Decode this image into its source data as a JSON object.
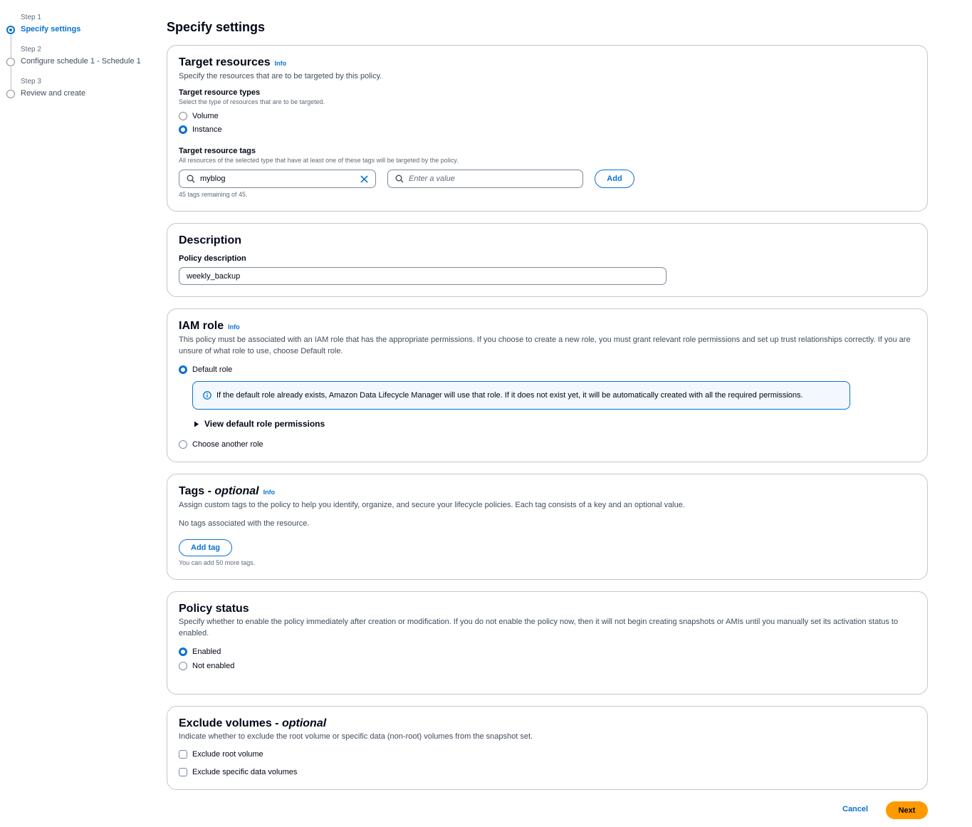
{
  "steps": [
    {
      "sub": "Step 1",
      "label": "Specify settings"
    },
    {
      "sub": "Step 2",
      "label": "Configure schedule 1 - Schedule 1"
    },
    {
      "sub": "Step 3",
      "label": "Review and create"
    }
  ],
  "page_title": "Specify settings",
  "target_resources": {
    "title": "Target resources",
    "info": "Info",
    "description": "Specify the resources that are to be targeted by this policy.",
    "types_label": "Target resource types",
    "types_hint": "Select the type of resources that are to be targeted.",
    "type_volume": "Volume",
    "type_instance": "Instance",
    "tags_label": "Target resource tags",
    "tags_hint": "All resources of the selected type that have at least one of these tags will be targeted by the policy.",
    "key_value": "myblog",
    "value_placeholder": "Enter a value",
    "add_label": "Add",
    "remaining": "45 tags remaining of 45."
  },
  "description_panel": {
    "title": "Description",
    "label": "Policy description",
    "value": "weekly_backup"
  },
  "iam_role": {
    "title": "IAM role",
    "info": "Info",
    "description": "This policy must be associated with an IAM role that has the appropriate permissions. If you choose to create a new role, you must grant relevant role permissions and set up trust relationships correctly. If you are unsure of what role to use, choose Default role.",
    "default_role": "Default role",
    "alert_text": "If the default role already exists, Amazon Data Lifecycle Manager will use that role. If it does not exist yet, it will be automatically created with all the required permissions.",
    "expand_label": "View default role permissions",
    "another_role": "Choose another role"
  },
  "tags_panel": {
    "title": "Tags -",
    "title_optional": "optional",
    "info": "Info",
    "description": "Assign custom tags to the policy to help you identify, organize, and secure your lifecycle policies. Each tag consists of a key and an optional value.",
    "empty": "No tags associated with the resource.",
    "add_tag": "Add tag",
    "hint": "You can add 50 more tags."
  },
  "policy_status": {
    "title": "Policy status",
    "description": "Specify whether to enable the policy immediately after creation or modification. If you do not enable the policy now, then it will not begin creating snapshots or AMIs until you manually set its activation status to enabled.",
    "enabled": "Enabled",
    "not_enabled": "Not enabled"
  },
  "exclude_volumes": {
    "title": "Exclude volumes -",
    "title_optional": "optional",
    "description": "Indicate whether to exclude the root volume or specific data (non-root) volumes from the snapshot set.",
    "root": "Exclude root volume",
    "data": "Exclude specific data volumes"
  },
  "footer": {
    "cancel": "Cancel",
    "next": "Next"
  },
  "colors": {
    "accent": "#0972d3",
    "primary_button": "#ff9900",
    "border": "#c6c6cd"
  },
  "icons": [
    "search-icon",
    "clear-icon",
    "info-circle-icon",
    "caret-right-icon"
  ]
}
